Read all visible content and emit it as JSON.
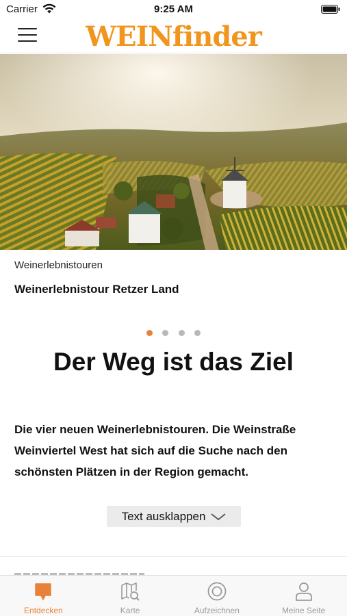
{
  "status_bar": {
    "carrier": "Carrier",
    "time": "9:25 AM"
  },
  "header": {
    "logo_text": "WEINfinder",
    "menu_icon": "hamburger-menu-icon",
    "brand_color": "#f0961e"
  },
  "hero": {
    "image_description_icon": "vineyard-windmill-photo"
  },
  "article": {
    "category": "Weinerlebnistouren",
    "title": "Weinerlebnistour Retzer Land"
  },
  "pager": {
    "total": 4,
    "active_index": 0,
    "active_color": "#e8823a"
  },
  "content": {
    "headline": "Der Weg ist das Ziel",
    "body": "Die vier neuen Weinerlebnistouren. Die Weinstraße Weinviertel West hat sich auf die Suche nach den schönsten Plätzen in der Region gemacht.",
    "expand_label": "Text ausklappen"
  },
  "tab_bar": {
    "tabs": [
      {
        "label": "Entdecken",
        "icon": "speech-bubble-icon",
        "active": true
      },
      {
        "label": "Karte",
        "icon": "map-search-icon",
        "active": false
      },
      {
        "label": "Aufzeichnen",
        "icon": "record-target-icon",
        "active": false
      },
      {
        "label": "Meine Seite",
        "icon": "user-profile-icon",
        "active": false
      }
    ]
  }
}
